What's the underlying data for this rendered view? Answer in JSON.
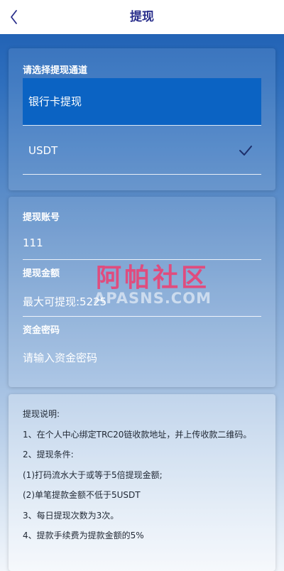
{
  "header": {
    "title": "提现"
  },
  "channel": {
    "label": "请选择提现通道",
    "options": [
      {
        "label": "银行卡提现",
        "selected": false
      },
      {
        "label": "USDT",
        "selected": true
      }
    ]
  },
  "form": {
    "account_label": "提现账号",
    "account_value": "111",
    "amount_label": "提现金额",
    "amount_value": "最大可提现:5225",
    "password_label": "资金密码",
    "password_placeholder": "请输入资金密码"
  },
  "notes": {
    "lines": [
      "提现说明:",
      "1、在个人中心绑定TRC20链收款地址，并上传收款二维码。",
      "2、提现条件:",
      "(1)打码流水大于或等于5倍提现金额;",
      "(2)单笔提款金额不低于5USDT",
      "3、每日提现次数为3次。",
      "4、提款手续费为提款金额的5%"
    ]
  },
  "watermark": {
    "text_cn": "阿帕社区",
    "text_en": "APASNS.COM"
  },
  "colors": {
    "title": "#2a2f8c",
    "selected_option_bg": "#0b63c3",
    "watermark": "#ee3c6e"
  }
}
